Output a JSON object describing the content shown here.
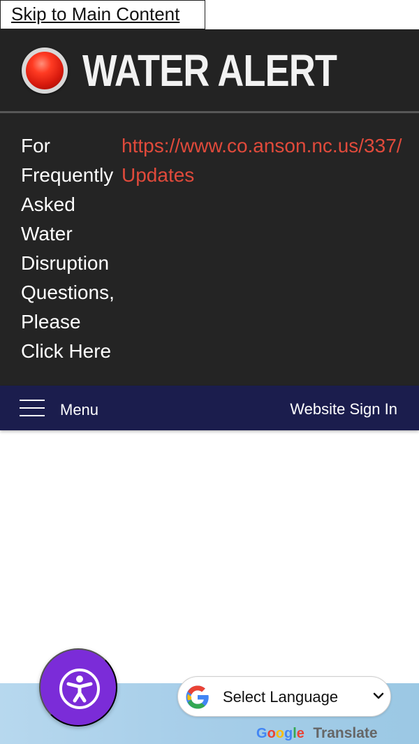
{
  "skip_link": {
    "label": "Skip to Main Content"
  },
  "alert": {
    "title": "WATER ALERT",
    "message_lines": [
      "For",
      "Frequently",
      "Asked",
      "Water",
      "Disruption",
      "Questions,",
      "Please",
      "Click Here"
    ],
    "link_lines": [
      "https://www.co.anson.nc.us/337/",
      "Updates"
    ],
    "colors": {
      "background": "#232323",
      "dot_red": "#e2261a",
      "link": "#e04a3b"
    }
  },
  "navigation": {
    "menu_label": "Menu",
    "sign_in_label": "Website Sign In",
    "background": "#1b1d4d"
  },
  "accessibility": {
    "icon": "accessibility-person-icon",
    "background": "#7b2cd8"
  },
  "translate": {
    "select_label": "Select Language",
    "powered_by": {
      "google_letters": [
        "G",
        "o",
        "o",
        "g",
        "l",
        "e"
      ],
      "word": "Translate"
    },
    "icon": "google-g-icon"
  },
  "footer": {
    "background": "#a7cee9"
  }
}
